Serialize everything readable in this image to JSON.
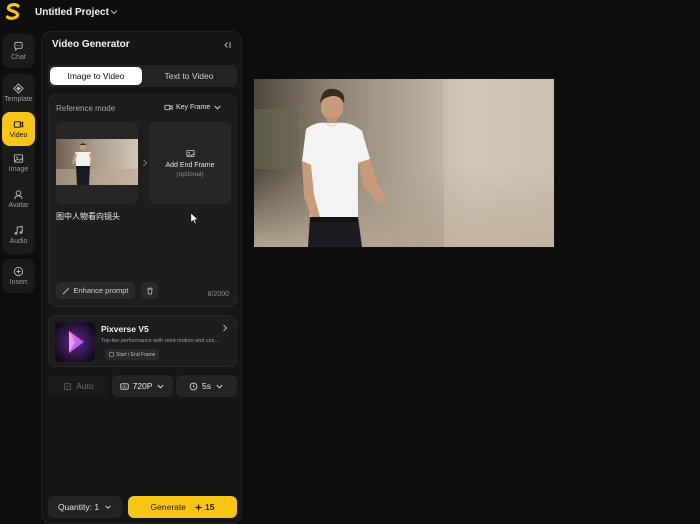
{
  "app": {
    "project_title": "Untitled Project",
    "icons": {
      "logo": "s-logo-icon",
      "project_menu": "chevron-down-icon"
    }
  },
  "sidebar": {
    "items": [
      {
        "label": "Chat",
        "icon": "chat-bubble-icon",
        "active": false
      },
      {
        "label": "Template",
        "icon": "template-icon",
        "active": false
      },
      {
        "label": "Video",
        "icon": "video-camera-icon",
        "active": true
      },
      {
        "label": "Image",
        "icon": "image-icon",
        "active": false
      },
      {
        "label": "Avatar",
        "icon": "avatar-icon",
        "active": false
      },
      {
        "label": "Audio",
        "icon": "music-note-icon",
        "active": false
      },
      {
        "label": "Insert",
        "icon": "plus-circle-icon",
        "active": false
      }
    ]
  },
  "panel": {
    "title": "Video Generator",
    "tabs": [
      {
        "label": "Image to Video",
        "active": true
      },
      {
        "label": "Text to Video",
        "active": false
      }
    ],
    "reference": {
      "label": "Reference mode",
      "mode": "Key Frame",
      "end_frame_title": "Add End Frame",
      "end_frame_sub": "(optional)"
    },
    "prompt": "图中人物看向镜头",
    "enhance_label": "Enhance prompt",
    "char_count": "8/2000",
    "model": {
      "name": "Pixverse V5",
      "description": "Top-tier performance with vivid motion and cris...",
      "tag": "Start / End Frame"
    },
    "options": {
      "auto": "Auto",
      "resolution": "720P",
      "duration": "5s"
    },
    "quantity": "Quantity: 1",
    "generate_label": "Generate",
    "generate_cost": "15"
  },
  "colors": {
    "accent": "#f7c614",
    "background": "#0e0e0e",
    "panel": "#161616"
  }
}
